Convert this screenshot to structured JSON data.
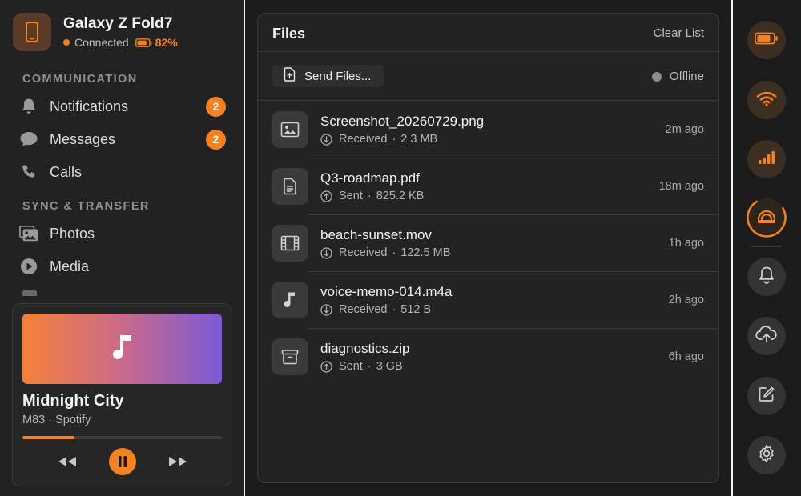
{
  "device": {
    "name": "Galaxy Z Fold7",
    "status": "Connected",
    "battery": "82%",
    "battery_level": 0.82,
    "icon": "phone-icon"
  },
  "sidebar": {
    "sections": [
      {
        "label": "COMMUNICATION",
        "items": [
          {
            "label": "Notifications",
            "badge": "2",
            "icon": "bell-icon"
          },
          {
            "label": "Messages",
            "badge": "2",
            "icon": "chat-bubble-icon"
          },
          {
            "label": "Calls",
            "badge": "",
            "icon": "phone-handset-icon"
          }
        ]
      },
      {
        "label": "SYNC & TRANSFER",
        "items": [
          {
            "label": "Photos",
            "icon": "photos-icon"
          },
          {
            "label": "Media",
            "icon": "play-circle-icon"
          }
        ]
      }
    ]
  },
  "player": {
    "title": "Midnight City",
    "subtitle": "M83 · Spotify",
    "progress": 0.26,
    "art_icon": "music-note-icon"
  },
  "files": {
    "title": "Files",
    "clear_label": "Clear List",
    "send_label": "Send Files...",
    "status": "Offline",
    "items": [
      {
        "name": "Screenshot_20260729.png",
        "direction": "Received",
        "size": "2.3 MB",
        "time": "2m ago",
        "icon": "image-icon"
      },
      {
        "name": "Q3-roadmap.pdf",
        "direction": "Sent",
        "size": "825.2 KB",
        "time": "18m ago",
        "icon": "document-icon"
      },
      {
        "name": "beach-sunset.mov",
        "direction": "Received",
        "size": "122.5 MB",
        "time": "1h ago",
        "icon": "film-icon"
      },
      {
        "name": "voice-memo-014.m4a",
        "direction": "Received",
        "size": "512 B",
        "time": "2h ago",
        "icon": "music-note-icon"
      },
      {
        "name": "diagnostics.zip",
        "direction": "Sent",
        "size": "3 GB",
        "time": "6h ago",
        "icon": "archive-icon"
      }
    ]
  },
  "rail": {
    "buttons": [
      "battery-icon",
      "wifi-icon",
      "signal-icon",
      "sync-icon",
      "bell-icon",
      "cloud-upload-icon",
      "edit-icon",
      "settings-icon"
    ]
  },
  "colors": {
    "accent": "#f58220",
    "background": "#1b1b1b",
    "panel": "#232323",
    "sidebar": "#222222"
  }
}
